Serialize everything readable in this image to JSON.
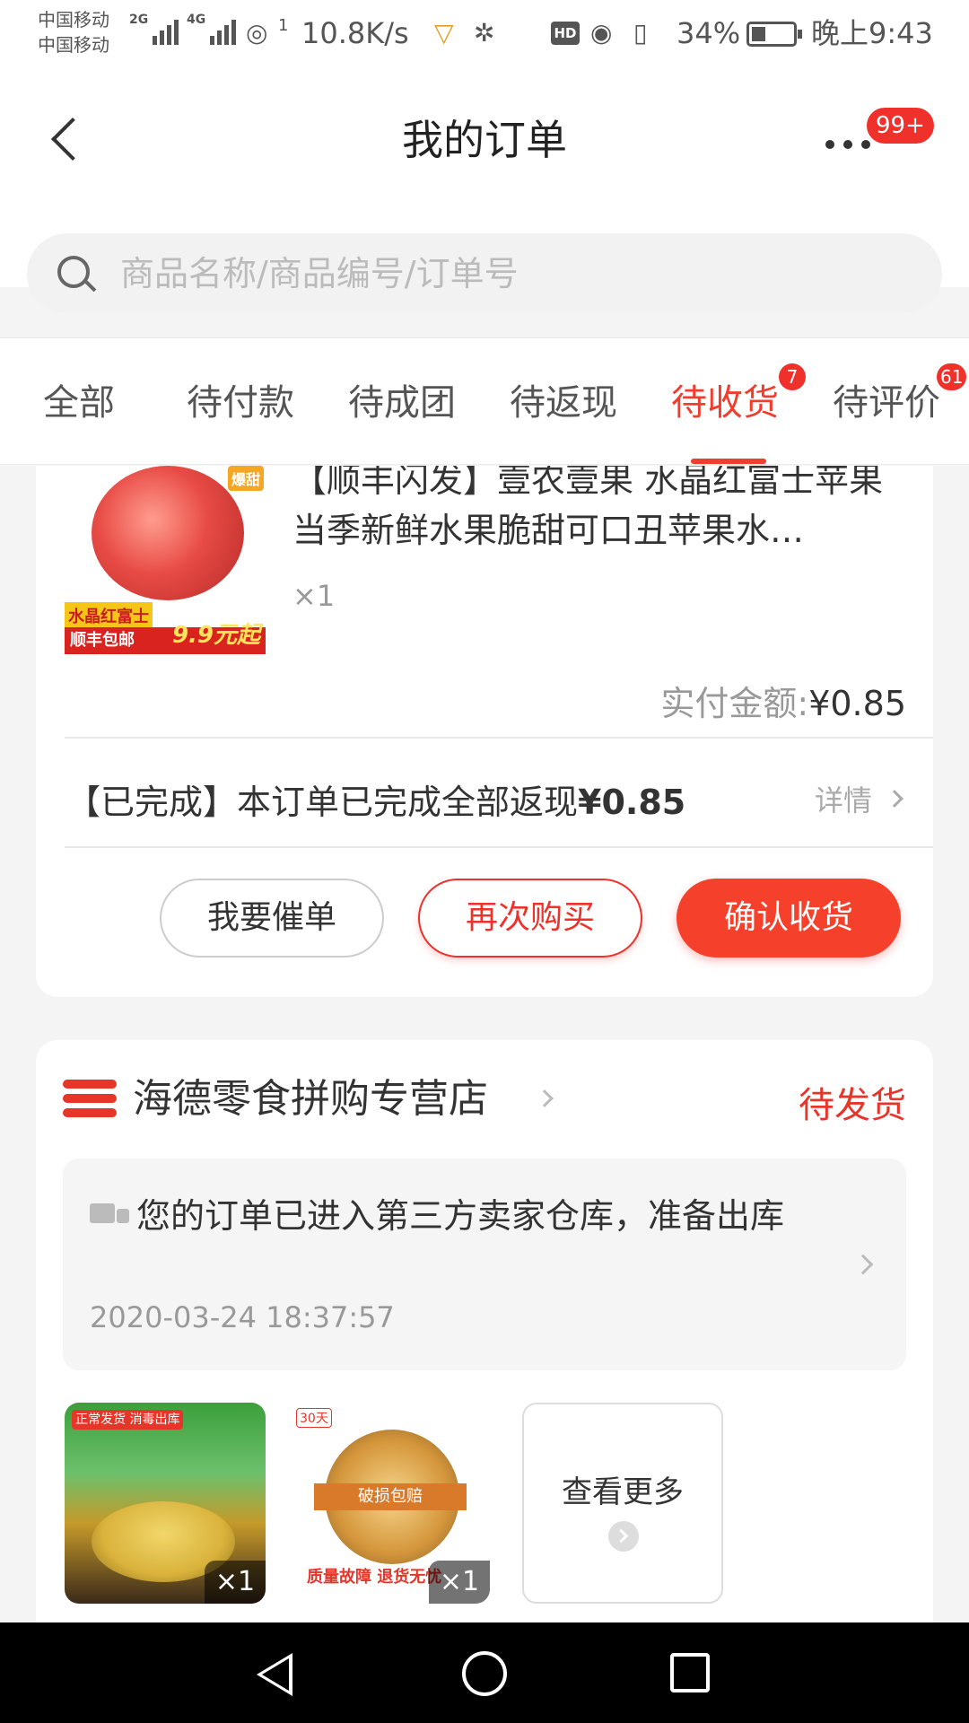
{
  "status_bar": {
    "carrier1": "中国移动",
    "carrier2": "中国移动",
    "net1": "2G",
    "net2": "4G",
    "hotspot_count": "1",
    "speed": "10.8K/s",
    "hd": "HD",
    "battery": "34%",
    "battery_level": 0.34,
    "time": "晚上9:43"
  },
  "header": {
    "title": "我的订单",
    "more_badge": "99+"
  },
  "search": {
    "placeholder": "商品名称/商品编号/订单号"
  },
  "tabs": [
    {
      "label": "全部",
      "active": false
    },
    {
      "label": "待付款",
      "active": false
    },
    {
      "label": "待成团",
      "active": false
    },
    {
      "label": "待返现",
      "active": false
    },
    {
      "label": "待收货",
      "active": true,
      "badge": "7"
    },
    {
      "label": "待评价",
      "active": false,
      "badge": "61"
    }
  ],
  "order1": {
    "image_tag": "爆甜",
    "image_label1": "水晶红富士",
    "image_label2": "顺丰包邮",
    "image_price": "9.9元起",
    "title": "【顺丰闪发】壹农壹果 水晶红富士苹果当季新鲜水果脆甜可口丑苹果水…",
    "quantity": "×1",
    "paid_label": "实付金额:",
    "paid_amount": "¥0.85",
    "cashback_text": "【已完成】本订单已完成全部返现",
    "cashback_amount": "¥0.85",
    "detail_label": "详情",
    "buttons": {
      "urge": "我要催单",
      "rebuy": "再次购买",
      "confirm": "确认收货"
    }
  },
  "order2": {
    "store_name": "海德零食拼购专营店",
    "status": "待发货",
    "logistics_text": "您的订单已进入第三方卖家仓库，准备出库",
    "logistics_time": "2020-03-24 18:37:57",
    "items": [
      {
        "quantity": "×1",
        "label": "正常发货 消毒出库"
      },
      {
        "quantity": "×1",
        "label": "30天",
        "ribbon": "破损包赔",
        "bottom": "质量故障  退货无忧"
      }
    ],
    "see_more": "查看更多"
  }
}
